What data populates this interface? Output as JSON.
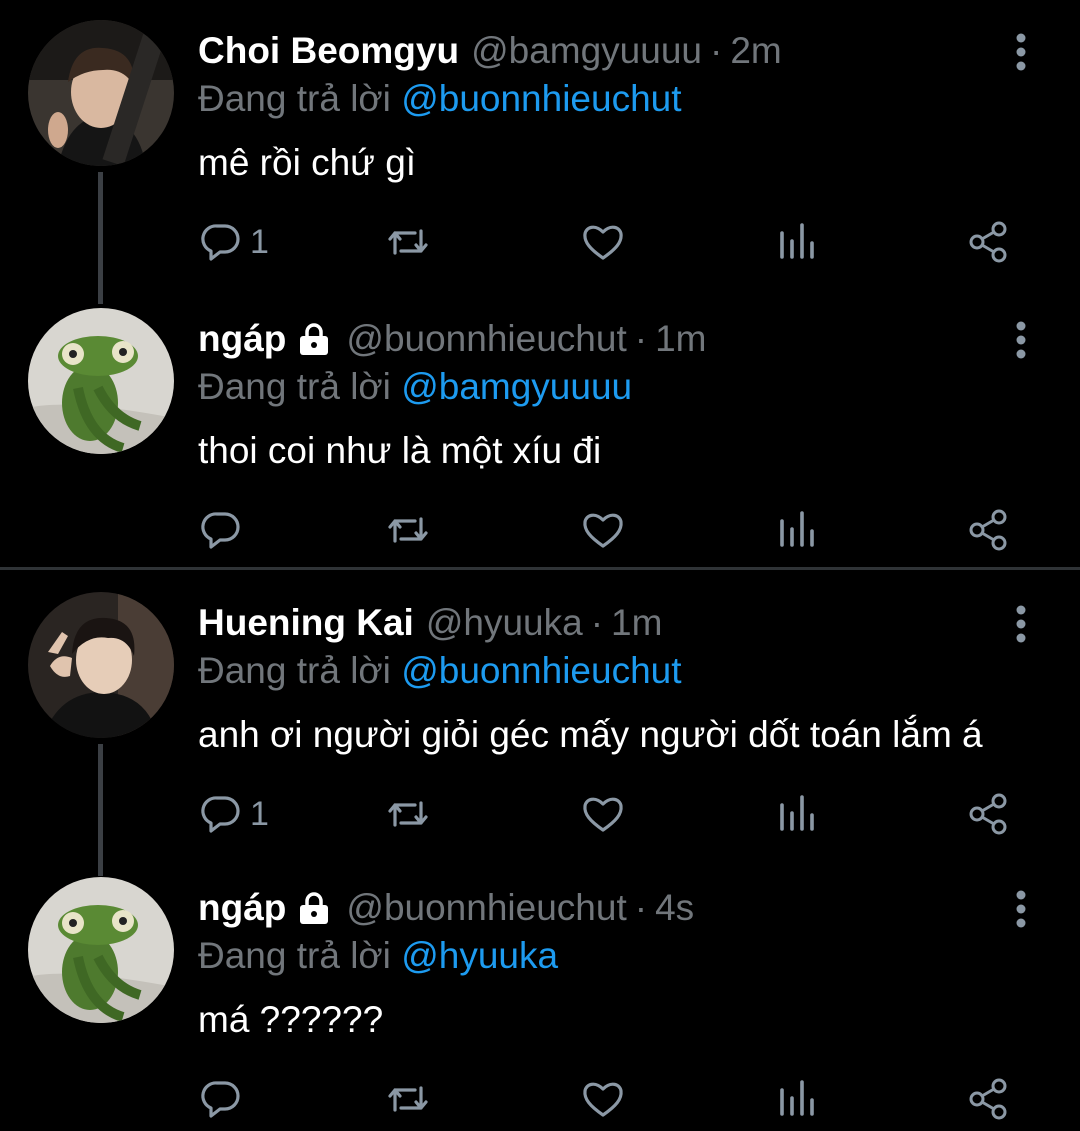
{
  "tweets": [
    {
      "name": "Choi Beomgyu",
      "handle": "@bamgyuuuu",
      "time": "2m",
      "reply_prefix": "Đang trả lời",
      "reply_to": "@buonnhieuchut",
      "text": "mê rồi chứ gì",
      "reply_count": "1",
      "locked": false
    },
    {
      "name": "ngáp",
      "handle": "@buonnhieuchut",
      "time": "1m",
      "reply_prefix": "Đang trả lời",
      "reply_to": "@bamgyuuuu",
      "text": "thoi coi như là một xíu đi",
      "reply_count": "",
      "locked": true
    },
    {
      "name": "Huening Kai",
      "handle": "@hyuuka",
      "time": "1m",
      "reply_prefix": "Đang trả lời",
      "reply_to": "@buonnhieuchut",
      "text": "anh ơi người giỏi géc mấy người dốt toán lắm á",
      "reply_count": "1",
      "locked": false
    },
    {
      "name": "ngáp",
      "handle": "@buonnhieuchut",
      "time": "4s",
      "reply_prefix": "Đang trả lời",
      "reply_to": "@hyuuka",
      "text": "má ??????",
      "reply_count": "",
      "locked": true
    }
  ],
  "separator": "·",
  "colors": {
    "background": "#000000",
    "text": "#ffffff",
    "secondary": "#71767b",
    "mention": "#1d9bf0",
    "icon": "#8b98a5",
    "thread_line": "#3b3f44"
  },
  "icons": [
    "reply-icon",
    "retweet-icon",
    "like-icon",
    "views-icon",
    "share-icon",
    "more-options-icon",
    "lock-icon"
  ]
}
